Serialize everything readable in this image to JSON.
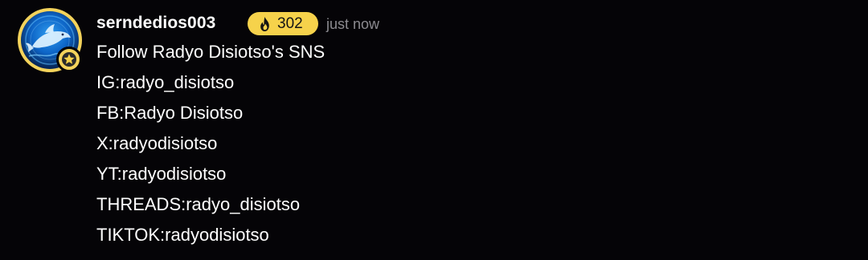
{
  "message": {
    "username": "serndedios003",
    "streak_count": "302",
    "timestamp": "just now",
    "lines": [
      "Follow Radyo Disiotso's SNS",
      "IG:radyo_disiotso",
      "FB:Radyo Disiotso",
      "X:radyodisiotso",
      "YT:radyodisiotso",
      "THREADS:radyo_disiotso",
      "TIKTOK:radyodisiotso"
    ]
  },
  "icons": {
    "avatar": "dolphin-avatar",
    "avatar_badge": "star-icon",
    "streak": "flame-icon"
  },
  "colors": {
    "background": "#050407",
    "accent_yellow": "#f6d24b",
    "text_primary": "#ffffff",
    "text_muted": "#8c8b90"
  }
}
